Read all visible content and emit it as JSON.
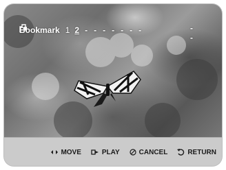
{
  "bookmark": {
    "label": "Bookmark",
    "slot_1": "1",
    "slot_2": "2",
    "empty_slots": [
      "-",
      "-",
      "-",
      "-",
      "-",
      "-",
      "-"
    ],
    "end_mark": "--"
  },
  "controls": {
    "move_label": "MOVE",
    "play_label": "PLAY",
    "cancel_label": "CANCEL",
    "return_label": "RETURN"
  },
  "icons": {
    "bookmark": "bookmark-icon",
    "move": "left-right-arrow-icon",
    "play": "play-key-icon",
    "cancel": "cancel-icon",
    "return": "return-arrow-icon"
  }
}
